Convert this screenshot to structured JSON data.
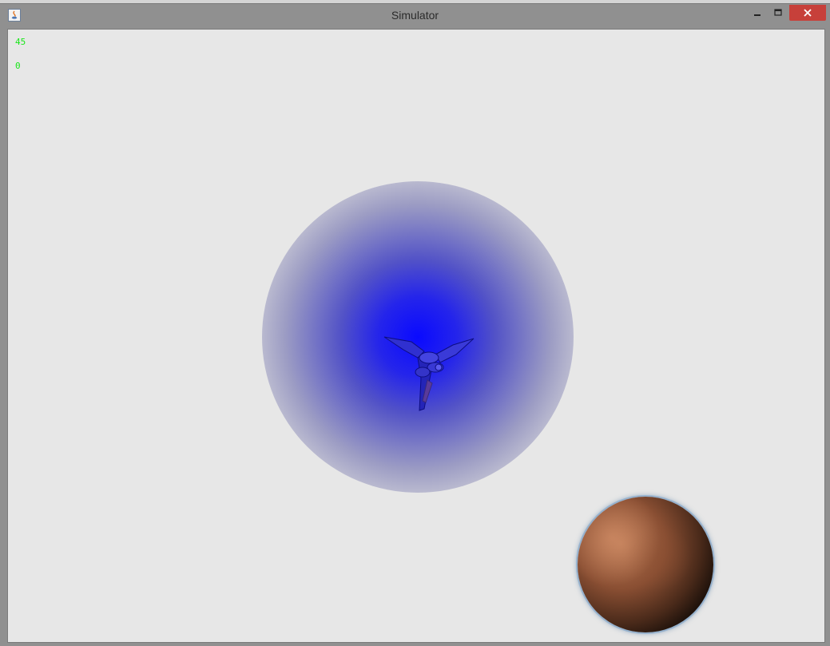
{
  "window": {
    "title": "Simulator",
    "controls": {
      "minimize_icon": "minimize-icon",
      "maximize_icon": "maximize-icon",
      "close_icon": "close-icon",
      "close_color": "#c7403a"
    }
  },
  "hud": {
    "line1": "45",
    "line2": "0",
    "color": "#19e619"
  },
  "scene": {
    "background": "#e7e7e7",
    "glow_color": "#0a0aff",
    "ship_icon": "spaceship-icon",
    "planet_icon": "planet-icon"
  }
}
